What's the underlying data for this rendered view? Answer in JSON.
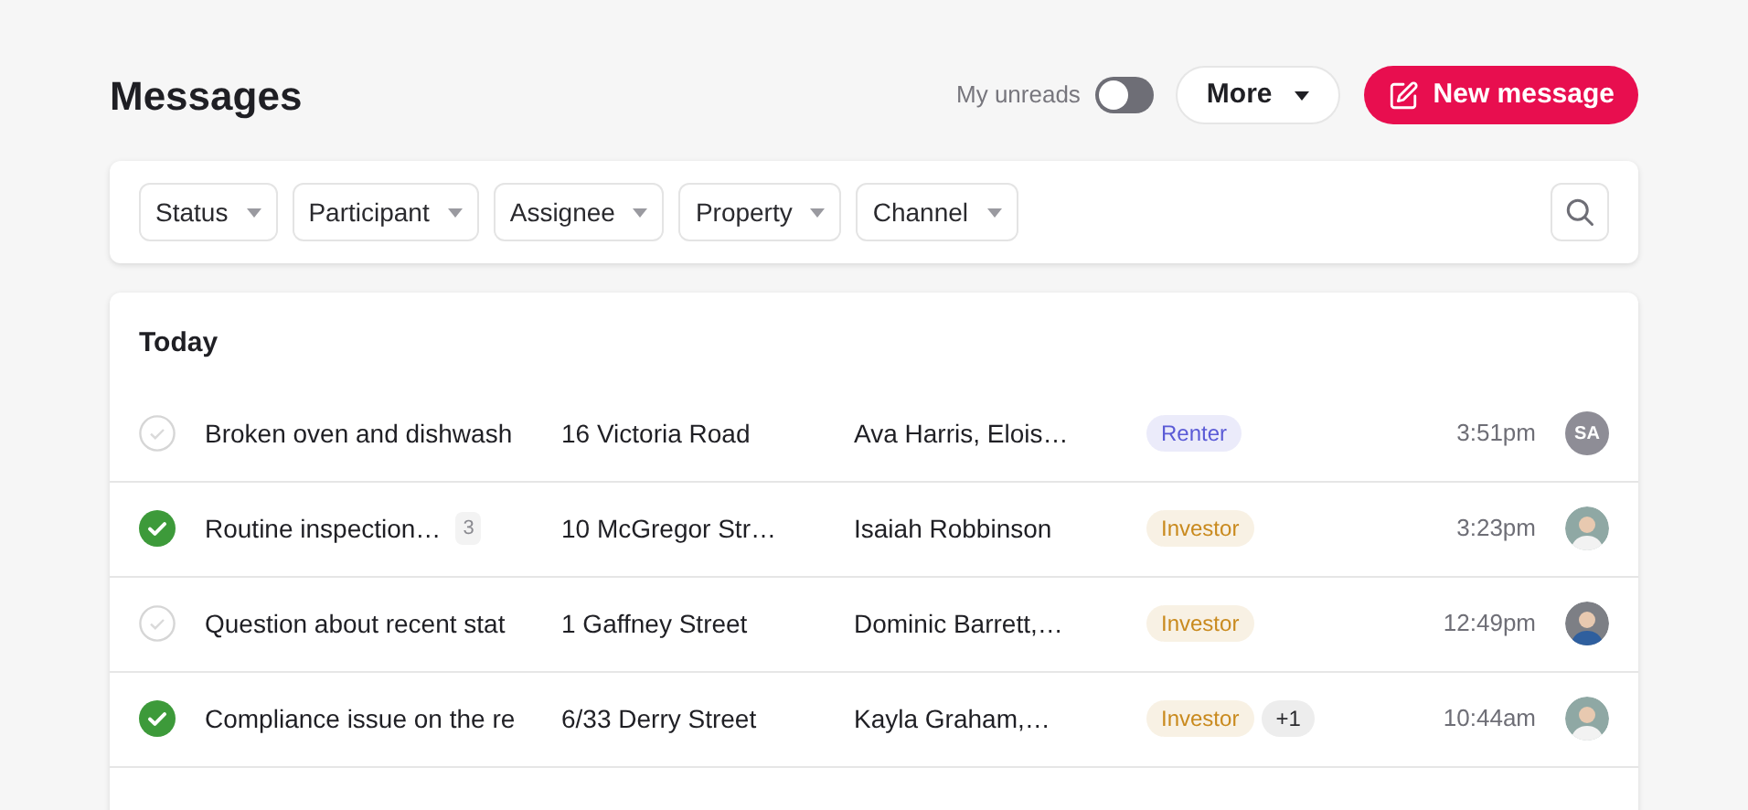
{
  "header": {
    "title": "Messages",
    "unreads_toggle": {
      "label": "My unreads",
      "on": false
    },
    "more_button": "More",
    "new_button": "New message"
  },
  "filters": [
    "Status",
    "Participant",
    "Assignee",
    "Property",
    "Channel"
  ],
  "list": {
    "group": "Today",
    "rows": [
      {
        "resolved": false,
        "subject": "Broken oven and dishwash",
        "property": "16 Victoria Road",
        "participants": "Ava Harris, Elois…",
        "tags": [
          {
            "label": "Renter",
            "color": "#5b5bd6"
          }
        ],
        "time": "3:51pm",
        "avatar": {
          "kind": "initials",
          "text": "SA"
        }
      },
      {
        "resolved": true,
        "subject": "Routine inspection…",
        "count": "3",
        "property": "10 McGregor Str…",
        "participants": "Isaiah Robbinson",
        "tags": [
          {
            "label": "Investor",
            "color": "#c98a1e"
          }
        ],
        "time": "3:23pm",
        "avatar": {
          "kind": "photo"
        }
      },
      {
        "resolved": false,
        "subject": "Question about recent stat",
        "property": "1 Gaffney Street",
        "participants": "Dominic Barrett,…",
        "tags": [
          {
            "label": "Investor",
            "color": "#c98a1e"
          }
        ],
        "time": "12:49pm",
        "avatar": {
          "kind": "photo"
        }
      },
      {
        "resolved": true,
        "subject": "Compliance issue on the re",
        "property": "6/33 Derry Street",
        "participants": "Kayla Graham,…",
        "tags": [
          {
            "label": "Investor",
            "color": "#c98a1e"
          }
        ],
        "extra": "+1",
        "time": "10:44am",
        "avatar": {
          "kind": "photo"
        }
      }
    ]
  }
}
